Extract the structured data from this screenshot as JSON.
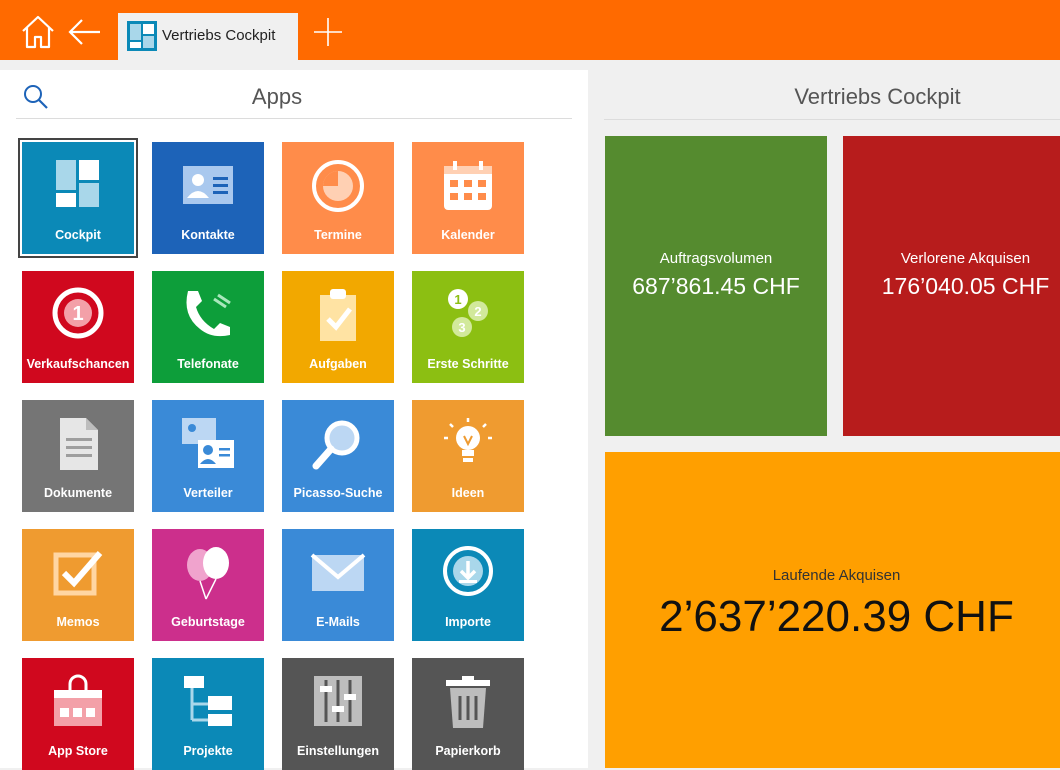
{
  "header": {
    "home_icon": "home-icon",
    "back_icon": "back-arrow-icon",
    "active_tab": "Vertriebs Cockpit",
    "add_tab_icon": "plus-icon"
  },
  "apps_panel": {
    "title": "Apps",
    "search_icon": "search-icon",
    "tiles": [
      {
        "label": "Cockpit",
        "color": "#0b89b7",
        "icon": "cockpit-icon"
      },
      {
        "label": "Kontakte",
        "color": "#1d63b8",
        "icon": "contact-card-icon"
      },
      {
        "label": "Termine",
        "color": "#ff8c4a",
        "icon": "clock-icon"
      },
      {
        "label": "Kalender",
        "color": "#ff8c4a",
        "icon": "calendar-icon"
      },
      {
        "label": "Verkaufschancen",
        "color": "#d0081e",
        "icon": "number-one-icon"
      },
      {
        "label": "Telefonate",
        "color": "#0d9e3a",
        "icon": "phone-icon"
      },
      {
        "label": "Aufgaben",
        "color": "#f2a800",
        "icon": "clipboard-check-icon"
      },
      {
        "label": "Erste Schritte",
        "color": "#8cbf12",
        "icon": "steps-123-icon"
      },
      {
        "label": "Dokumente",
        "color": "#757575",
        "icon": "document-icon"
      },
      {
        "label": "Verteiler",
        "color": "#3a8ad7",
        "icon": "contact-cards-icon"
      },
      {
        "label": "Picasso-Suche",
        "color": "#3a8ad7",
        "icon": "magnifier-icon"
      },
      {
        "label": "Ideen",
        "color": "#ef9b30",
        "icon": "lightbulb-icon"
      },
      {
        "label": "Memos",
        "color": "#ef9b30",
        "icon": "checkbox-icon"
      },
      {
        "label": "Geburtstage",
        "color": "#cc2f8c",
        "icon": "balloons-icon"
      },
      {
        "label": "E-Mails",
        "color": "#3a8ad7",
        "icon": "envelope-icon"
      },
      {
        "label": "Importe",
        "color": "#0b89b7",
        "icon": "download-icon"
      },
      {
        "label": "App Store",
        "color": "#d0081e",
        "icon": "shopping-bag-icon"
      },
      {
        "label": "Projekte",
        "color": "#0b89b7",
        "icon": "tree-structure-icon"
      },
      {
        "label": "Einstellungen",
        "color": "#555555",
        "icon": "sliders-icon"
      },
      {
        "label": "Papierkorb",
        "color": "#555555",
        "icon": "trash-icon"
      }
    ]
  },
  "cockpit_panel": {
    "title": "Vertriebs Cockpit",
    "kpis": [
      {
        "label": "Auftragsvolumen",
        "value": "687’861.45 CHF",
        "color": "#558b2f"
      },
      {
        "label": "Verlorene Akquisen",
        "value": "176’040.05 CHF",
        "color": "#b71c1c"
      },
      {
        "label": "Laufende Akquisen",
        "value": "2’637’220.39 CHF",
        "color": "#ff9f00"
      }
    ]
  }
}
